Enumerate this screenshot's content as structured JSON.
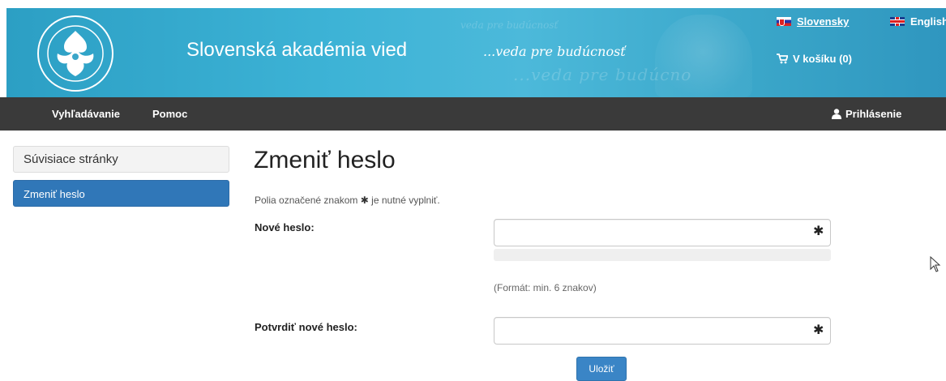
{
  "header": {
    "site_title": "Slovenská akadémia vied",
    "tagline": "...veda pre budúcnosť",
    "ghost_text_small": "veda pre budúcnosť",
    "ghost_text_large": "...veda pre budúcno",
    "languages": [
      {
        "label": "Slovensky",
        "flag": "slovak-flag"
      },
      {
        "label": "English",
        "flag": "uk-flag"
      }
    ],
    "cart_label": "V košíku (0)",
    "logo_icon": "sav-logo"
  },
  "nav": {
    "items": [
      {
        "label": "Vyhľadávanie"
      },
      {
        "label": "Pomoc"
      }
    ],
    "login_label": "Prihlásenie"
  },
  "sidebar": {
    "heading": "Súvisiace stránky",
    "items": [
      {
        "label": "Zmeniť heslo",
        "active": true
      }
    ]
  },
  "main": {
    "title": "Zmeniť heslo",
    "required_note_before": "Polia označené znakom",
    "required_note_after": "je nutné vyplniť.",
    "required_symbol": "✱",
    "fields": {
      "new_password": {
        "label": "Nové heslo:",
        "value": ""
      },
      "confirm_password": {
        "label": "Potvrdiť nové heslo:",
        "value": ""
      }
    },
    "format_hint": "(Formát: min. 6 znakov)",
    "save_label": "Uložiť"
  },
  "colors": {
    "banner": "#3db3d6",
    "navbar": "#3a3a3a",
    "active_item": "#3077b8",
    "button": "#3a85c6"
  }
}
